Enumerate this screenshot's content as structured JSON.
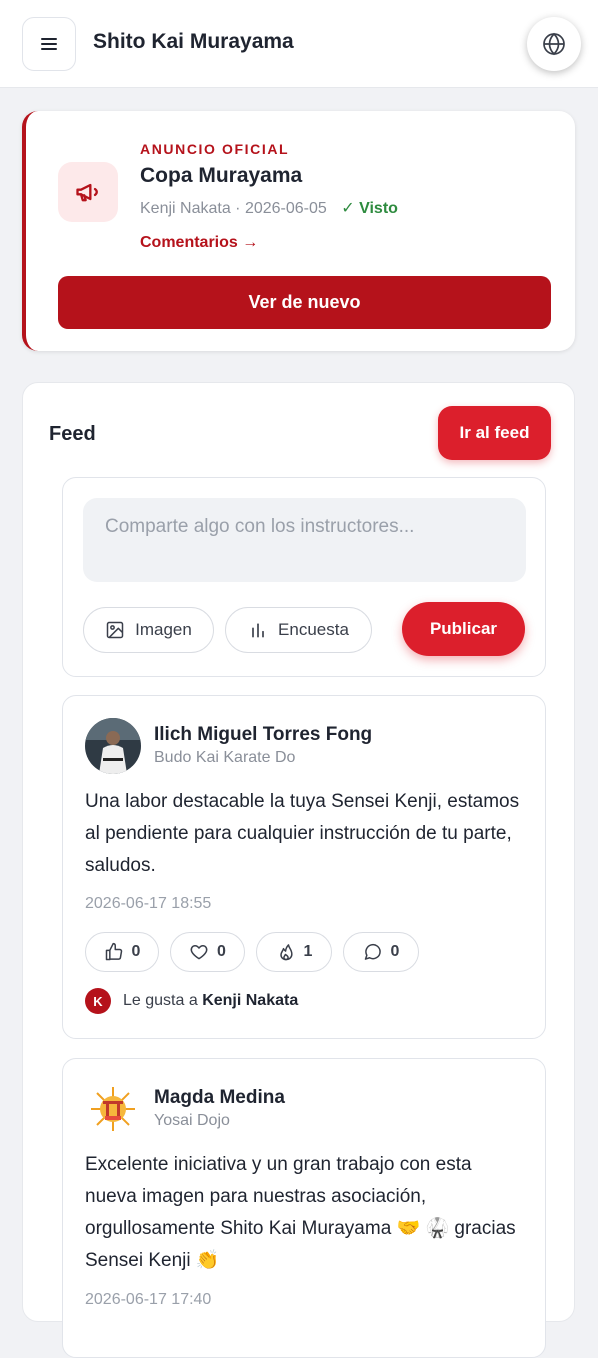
{
  "header": {
    "title": "Shito Kai Murayama",
    "menu_icon": "menu-icon",
    "globe_icon": "globe-icon"
  },
  "announcement": {
    "kicker": "ANUNCIO OFICIAL",
    "title": "Copa Murayama",
    "author": "Kenji Nakata",
    "date": "2026-06-05",
    "seen_label": "✓ Visto",
    "comments_link": "Comentarios →",
    "button_label": "Ver de nuevo",
    "icon": "megaphone-icon",
    "accent_color": "#b5121b"
  },
  "feed": {
    "title": "Feed",
    "go_button": "Ir al feed",
    "composer": {
      "placeholder": "Comparte algo con los instructores...",
      "image_label": "Imagen",
      "poll_label": "Encuesta",
      "publish_label": "Publicar"
    },
    "posts": [
      {
        "author": "Ilich Miguel Torres Fong",
        "dojo": "Budo Kai Karate Do",
        "body": "Una labor destacable la tuya Sensei Kenji, estamos al pendiente para cualquier instrucción de tu parte, saludos.",
        "time": "2026-06-17 18:55",
        "reactions": {
          "like": "0",
          "heart": "0",
          "fire": "1",
          "comment": "0"
        },
        "liked_by_prefix": "Le gusta a",
        "liked_by_name": "Kenji Nakata",
        "liked_by_initial": "K"
      },
      {
        "author": "Magda Medina",
        "dojo": "Yosai Dojo",
        "body": "Excelente iniciativa y un gran trabajo con esta nueva imagen para nuestras asociación, orgullosamente Shito Kai Murayama 🤝 🥋 gracias Sensei Kenji 👏",
        "time": "2026-06-17 17:40"
      }
    ]
  },
  "colors": {
    "brand_red": "#dc1f2c",
    "dark_red": "#b5121b",
    "seen_green": "#2e8b3f"
  }
}
